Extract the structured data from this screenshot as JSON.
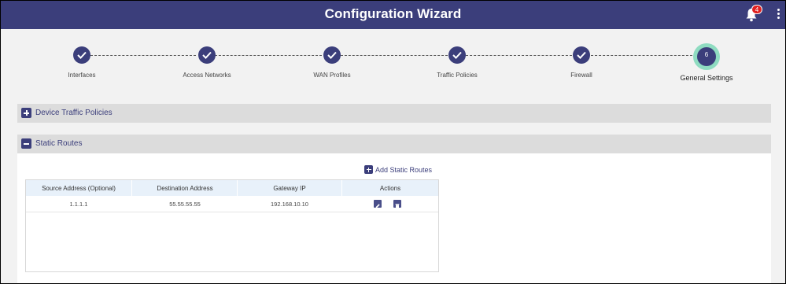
{
  "header": {
    "title": "Configuration Wizard",
    "notification_count": "4"
  },
  "stepper": {
    "steps": [
      {
        "label": "Interfaces",
        "status": "complete"
      },
      {
        "label": "Access Networks",
        "status": "complete"
      },
      {
        "label": "WAN Profiles",
        "status": "complete"
      },
      {
        "label": "Traffic Policies",
        "status": "complete"
      },
      {
        "label": "Firewall",
        "status": "complete"
      },
      {
        "label": "General Settings",
        "status": "active",
        "number": "6"
      }
    ]
  },
  "sections": {
    "device_traffic_policies": {
      "label": "Device Traffic Policies",
      "expanded": false
    },
    "static_routes": {
      "label": "Static Routes",
      "expanded": true
    }
  },
  "static_routes": {
    "add_label": "Add Static Routes",
    "columns": [
      "Source Address (Optional)",
      "Destination Address",
      "Gateway IP",
      "Actions"
    ],
    "rows": [
      {
        "source": "1.1.1.1",
        "destination": "55.55.55.55",
        "gateway": "192.168.10.10"
      }
    ]
  },
  "colors": {
    "brand": "#3b3e7b",
    "active_ring": "#8fdcc1",
    "badge": "#e02020",
    "table_header": "#e8f1fa"
  }
}
